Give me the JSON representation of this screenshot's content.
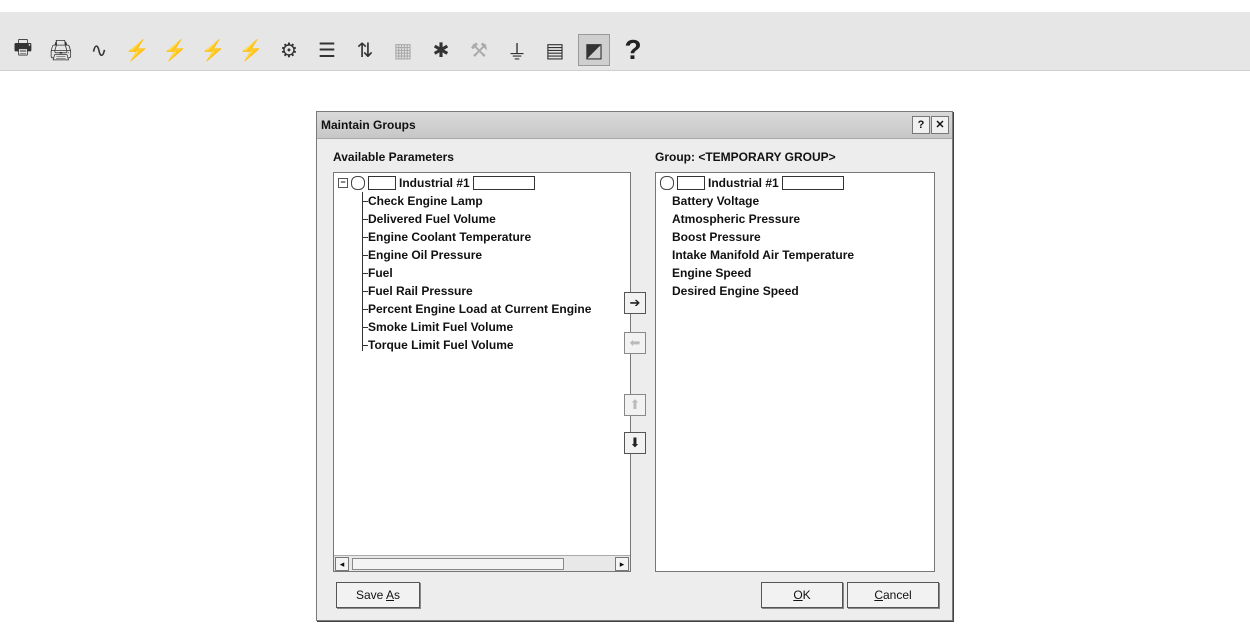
{
  "toolbar": {
    "icons": [
      "print-icon",
      "print-preview-icon",
      "waveform-icon",
      "flash-icon",
      "flash-icon",
      "flash-icon",
      "flash-icon",
      "calibrate-icon",
      "list-icon",
      "counter-icon",
      "grid-icon",
      "bug-icon",
      "tool-icon",
      "plug-icon",
      "document-icon",
      "chart-icon"
    ],
    "help_label": "?"
  },
  "dialog": {
    "title": "Maintain Groups",
    "help_label": "?",
    "close_label": "✕",
    "available_header": "Available Parameters",
    "group_header": "Group: <TEMPORARY GROUP>",
    "available_root": "Industrial #1",
    "available_items": [
      "Check Engine Lamp",
      "Delivered Fuel Volume",
      "Engine Coolant Temperature",
      "Engine Oil Pressure",
      "Fuel",
      "Fuel Rail Pressure",
      "Percent Engine Load at Current Engine",
      "Smoke Limit Fuel Volume",
      "Torque Limit Fuel Volume"
    ],
    "group_root": "Industrial #1",
    "group_items": [
      "Battery Voltage",
      "Atmospheric Pressure",
      "Boost Pressure",
      "Intake Manifold Air Temperature",
      "Engine Speed",
      "Desired Engine Speed"
    ],
    "buttons": {
      "save_as_prefix": "Save ",
      "save_as_mnemonic": "A",
      "save_as_suffix": "s",
      "ok_mnemonic": "O",
      "ok_suffix": "K",
      "cancel_mnemonic": "C",
      "cancel_suffix": "ancel"
    },
    "move": {
      "add": "➔",
      "remove": "⬅",
      "up": "⬆",
      "down": "⬇"
    }
  }
}
